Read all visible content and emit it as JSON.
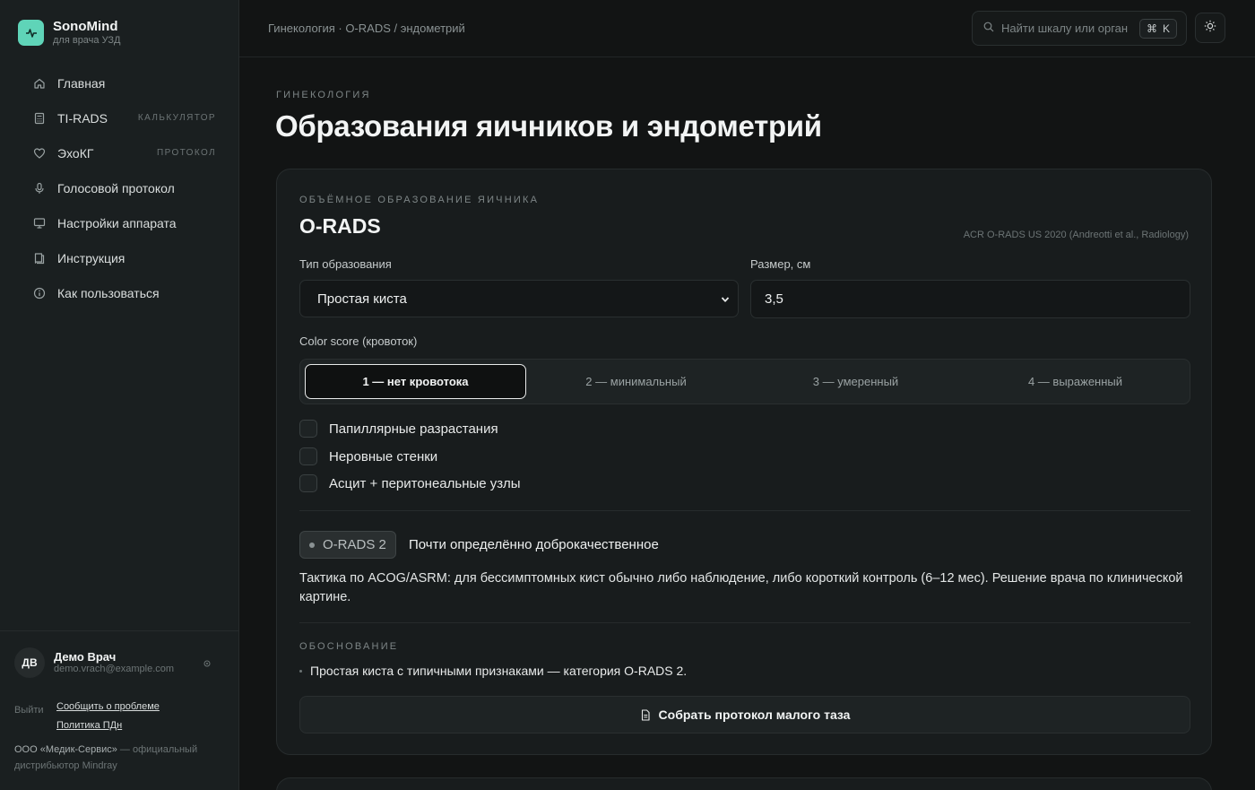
{
  "brand": {
    "name": "SonoMind",
    "subtitle": "для врача УЗД"
  },
  "nav": [
    {
      "label": "Главная",
      "tag": "",
      "icon": "home-icon"
    },
    {
      "label": "TI-RADS",
      "tag": "КАЛЬКУЛЯТОР",
      "icon": "calculator-icon"
    },
    {
      "label": "ЭхоКГ",
      "tag": "ПРОТОКОЛ",
      "icon": "heart-icon"
    },
    {
      "label": "Голосовой протокол",
      "tag": "",
      "icon": "microphone-icon"
    },
    {
      "label": "Настройки аппарата",
      "tag": "",
      "icon": "monitor-icon"
    },
    {
      "label": "Инструкция",
      "tag": "",
      "icon": "book-icon"
    },
    {
      "label": "Как пользоваться",
      "tag": "",
      "icon": "info-icon"
    }
  ],
  "user": {
    "initials": "ДВ",
    "name": "Демо Врач",
    "email": "demo.vrach@example.com"
  },
  "footer": {
    "logout": "Выйти",
    "report": "Сообщить о проблеме",
    "policy": "Политика ПДн",
    "company": "ООО «Медик-Сервис»",
    "distributor": " — официальный дистрибьютор Mindray"
  },
  "topbar": {
    "breadcrumb": "Гинекология · O-RADS / эндометрий",
    "search_placeholder": "Найти шкалу или орган",
    "shortcut_symbol": "⌘",
    "shortcut_key": "K"
  },
  "page": {
    "eyebrow": "ГИНЕКОЛОГИЯ",
    "title": "Образования яичников и эндометрий"
  },
  "card": {
    "eyebrow": "ОБЪЁМНОЕ ОБРАЗОВАНИЕ ЯИЧНИКА",
    "title": "O-RADS",
    "source": "ACR O-RADS US 2020 (Andreotti et al., Radiology)",
    "type_label": "Тип образования",
    "type_value": "Простая киста",
    "size_label": "Размер, см",
    "size_value": "3,5",
    "color_label": "Color score (кровоток)",
    "color_options": [
      "1 — нет кровотока",
      "2 — минимальный",
      "3 — умеренный",
      "4 — выраженный"
    ],
    "color_selected_index": 0,
    "checks": [
      "Папиллярные разрастания",
      "Неровные стенки",
      "Асцит + перитонеальные узлы"
    ],
    "result_badge": "O-RADS 2",
    "result_text": "Почти определённо доброкачественное",
    "tactics": "Тактика по ACOG/ASRM: для бессимптомных кист обычно либо наблюдение, либо короткий контроль (6–12 мес). Решение врача по клинической картине.",
    "reason_title": "ОБОСНОВАНИЕ",
    "reason_item": "Простая киста с типичными признаками — категория O-RADS 2.",
    "protocol_button": "Собрать протокол малого таза"
  },
  "colors": {
    "accent": "#5fd4b8",
    "background": "#121414",
    "card": "#181c1d"
  }
}
